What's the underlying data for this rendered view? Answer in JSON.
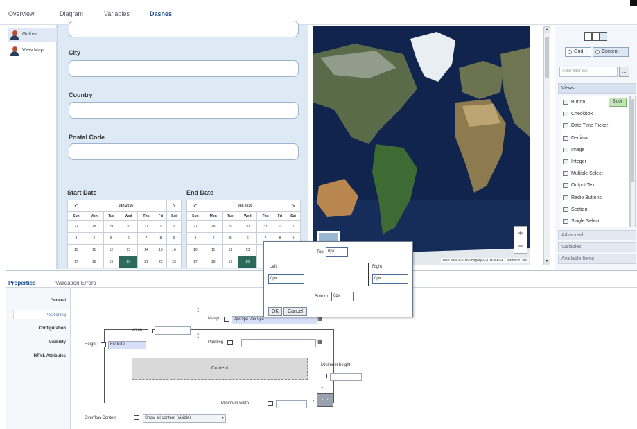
{
  "top_tabs": [
    "Overview",
    "Diagram",
    "Variables",
    "Dashes"
  ],
  "left_nav": [
    {
      "label": "Gather..."
    },
    {
      "label": "View Map"
    }
  ],
  "form": {
    "fields": [
      {
        "label": "City"
      },
      {
        "label": "Country"
      },
      {
        "label": "Postal Code"
      }
    ],
    "start_date": {
      "title": "Start Date",
      "month": "Jan 2016",
      "prev": "<",
      "next": ">",
      "days": [
        "Sun",
        "Mon",
        "Tue",
        "Wed",
        "Thu",
        "Fri",
        "Sat"
      ],
      "weeks": [
        [
          "27",
          "28",
          "29",
          "30",
          "31",
          "1",
          "2"
        ],
        [
          "3",
          "4",
          "5",
          "6",
          "7",
          "8",
          "9"
        ],
        [
          "10",
          "11",
          "12",
          "13",
          "14",
          "15",
          "16"
        ],
        [
          "17",
          "18",
          "19",
          "20",
          "21",
          "22",
          "23"
        ]
      ],
      "selected": "20"
    },
    "end_date": {
      "title": "End Date",
      "month": "Jan 2016",
      "prev": "<",
      "next": ">",
      "days": [
        "Sun",
        "Mon",
        "Tue",
        "Wed",
        "Thu",
        "Fri",
        "Sat"
      ],
      "weeks": [
        [
          "27",
          "28",
          "29",
          "30",
          "31",
          "1",
          "2"
        ],
        [
          "3",
          "4",
          "5",
          "6",
          "7",
          "8",
          "9"
        ],
        [
          "10",
          "11",
          "12",
          "13",
          "14",
          "",
          ""
        ],
        [
          "17",
          "18",
          "19",
          "20",
          "21",
          "",
          ""
        ]
      ],
      "selected": "20"
    }
  },
  "map": {
    "zoom_in": "+",
    "zoom_out": "−",
    "credits": "Map data ©2016 Imagery ©2016 NASA · Terms of Use"
  },
  "right_panel": {
    "grid_label": "Grid",
    "content_label": "Content",
    "filter_placeholder": "enter filter text",
    "filter_btn": "...",
    "views_label": "Views",
    "items": [
      "Button",
      "Checkbox",
      "Date Time Picker",
      "Decimal",
      "Image",
      "Integer",
      "Multiple Select",
      "Output Text",
      "Radio Buttons",
      "Section",
      "Single Select"
    ],
    "block_label": "Block",
    "sections": [
      "Advanced",
      "Variables",
      "Available Items"
    ]
  },
  "bottom": {
    "tabs": [
      "Properties",
      "Validation Errors"
    ],
    "side_items": [
      "General",
      "Positioning",
      "Configuration",
      "Visibility",
      "HTML Attributes"
    ],
    "selected_side": "Positioning",
    "margin_label": "Margin",
    "margin_value": "0px 0px 0px 0px",
    "width_label": "Width",
    "height_label": "Height",
    "height_value": "Fill Size",
    "padding_label": "Padding",
    "content_label": "Content",
    "min_height_label": "Minimum height",
    "min_width_label": "Minimum width",
    "overflow_label": "Overflow Content",
    "overflow_value": "Show all content (visible)"
  },
  "popup": {
    "top_label": "Top",
    "top_value": "0px",
    "left_label": "Left",
    "left_value": "0px",
    "right_label": "Right",
    "right_value": "0px",
    "bottom_label": "Bottom",
    "bottom_value": "0px",
    "ok": "OK",
    "cancel": "Cancel"
  },
  "colors": {
    "accent": "#1f4f8f",
    "selected_day": "#2c6a5b",
    "form_bg": "#dde9f4",
    "ocean": "#0e1f44"
  }
}
